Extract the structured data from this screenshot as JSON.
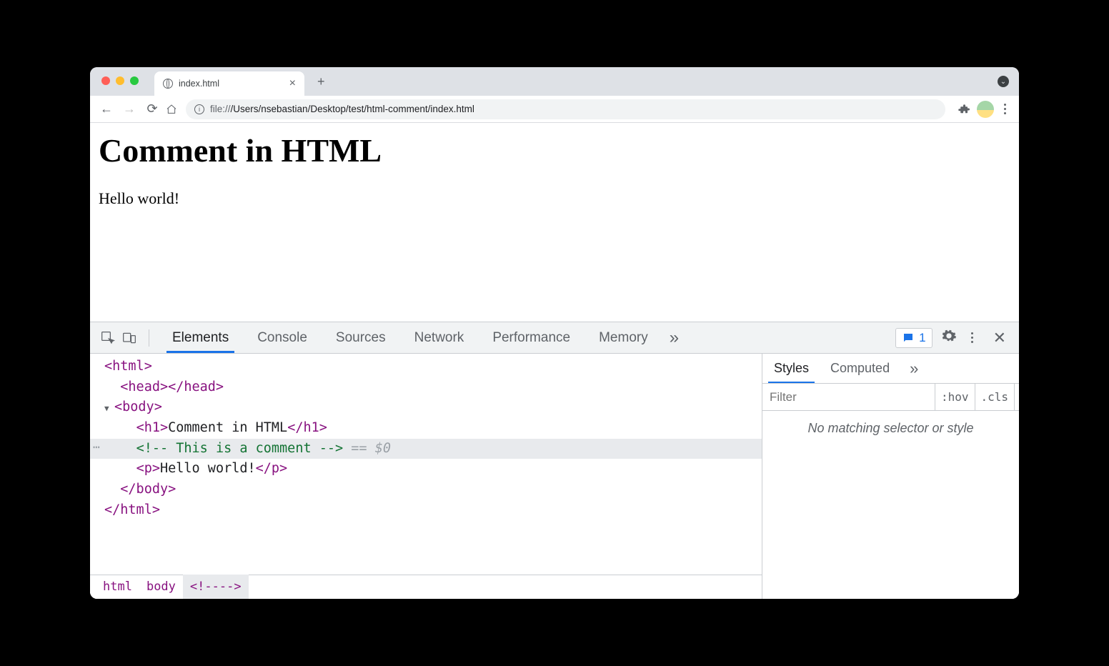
{
  "browser": {
    "tab_title": "index.html",
    "new_tab": "+",
    "url": "file:///Users/nsebastian/Desktop/test/html-comment/index.html",
    "url_prefix": "file://",
    "url_path": "/Users/nsebastian/Desktop/test/html-comment/index.html"
  },
  "page": {
    "heading": "Comment in HTML",
    "paragraph": "Hello world!"
  },
  "devtools": {
    "tabs": [
      "Elements",
      "Console",
      "Sources",
      "Network",
      "Performance",
      "Memory"
    ],
    "active_tab": "Elements",
    "issue_count": "1",
    "styles": {
      "tabs": [
        "Styles",
        "Computed"
      ],
      "active": "Styles",
      "filter_placeholder": "Filter",
      "hov": ":hov",
      "cls": ".cls",
      "message": "No matching selector or style"
    },
    "tree": {
      "html_open": "<html>",
      "head": "<head></head>",
      "body_open": "<body>",
      "h1_open": "<h1>",
      "h1_text": "Comment in HTML",
      "h1_close": "</h1>",
      "comment": "<!-- This is a comment -->",
      "eq": " == ",
      "ds": "$0",
      "p_open": "<p>",
      "p_text": "Hello world!",
      "p_close": "</p>",
      "body_close": "</body>",
      "html_close": "</html>"
    },
    "crumbs": [
      "html",
      "body",
      "<!--​-->"
    ]
  }
}
